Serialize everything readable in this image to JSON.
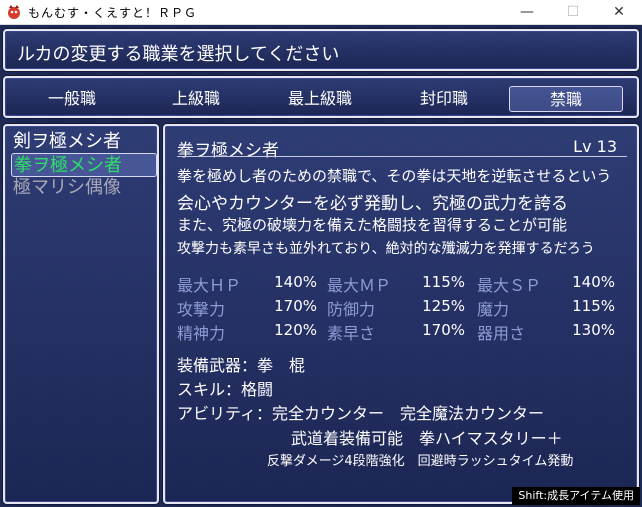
{
  "window": {
    "title": "もんむす・くえすと！ＲＰＧ",
    "minimize": "—",
    "maximize": "☐",
    "close": "✕"
  },
  "help": {
    "text": "ルカの変更する職業を選択してください"
  },
  "tabs": [
    {
      "label": "一般職"
    },
    {
      "label": "上級職"
    },
    {
      "label": "最上級職"
    },
    {
      "label": "封印職"
    },
    {
      "label": "禁職"
    }
  ],
  "job_list": [
    {
      "label": "剣ヲ極メシ者"
    },
    {
      "label": "拳ヲ極メシ者"
    },
    {
      "label": "極マリシ偶像"
    }
  ],
  "detail": {
    "name": "拳ヲ極メシ者",
    "level": "Lv 13",
    "desc": [
      "拳を極めし者のための禁職で、その拳は天地を逆転させるという",
      "会心やカウンターを必ず発動し、究極の武力を誇る",
      "また、究極の破壊力を備えた格闘技を習得することが可能",
      "攻撃力も素早さも並外れており、絶対的な殲滅力を発揮するだろう"
    ],
    "stats": [
      {
        "label": "最大ＨＰ",
        "value": "140%"
      },
      {
        "label": "最大ＭＰ",
        "value": "115%"
      },
      {
        "label": "最大ＳＰ",
        "value": "140%"
      },
      {
        "label": "攻撃力",
        "value": "170%"
      },
      {
        "label": "防御力",
        "value": "125%"
      },
      {
        "label": "魔力",
        "value": "115%"
      },
      {
        "label": "精神力",
        "value": "120%"
      },
      {
        "label": "素早さ",
        "value": "170%"
      },
      {
        "label": "器用さ",
        "value": "130%"
      }
    ],
    "weapon": "装備武器：拳　棍",
    "skill": "スキル：格闘",
    "abilities_1": "アビリティ：完全カウンター　完全魔法カウンター",
    "abilities_2": "武道着装備可能　拳ハイマスタリー＋",
    "abilities_3": "反撃ダメージ4段階強化　回避時ラッシュタイム発動"
  },
  "hint": "Shift:成長アイテム使用",
  "colors": {
    "selected_text": "#2de06a",
    "disabled_text": "#a8a8b8",
    "stat_label": "#8f9bd6"
  }
}
